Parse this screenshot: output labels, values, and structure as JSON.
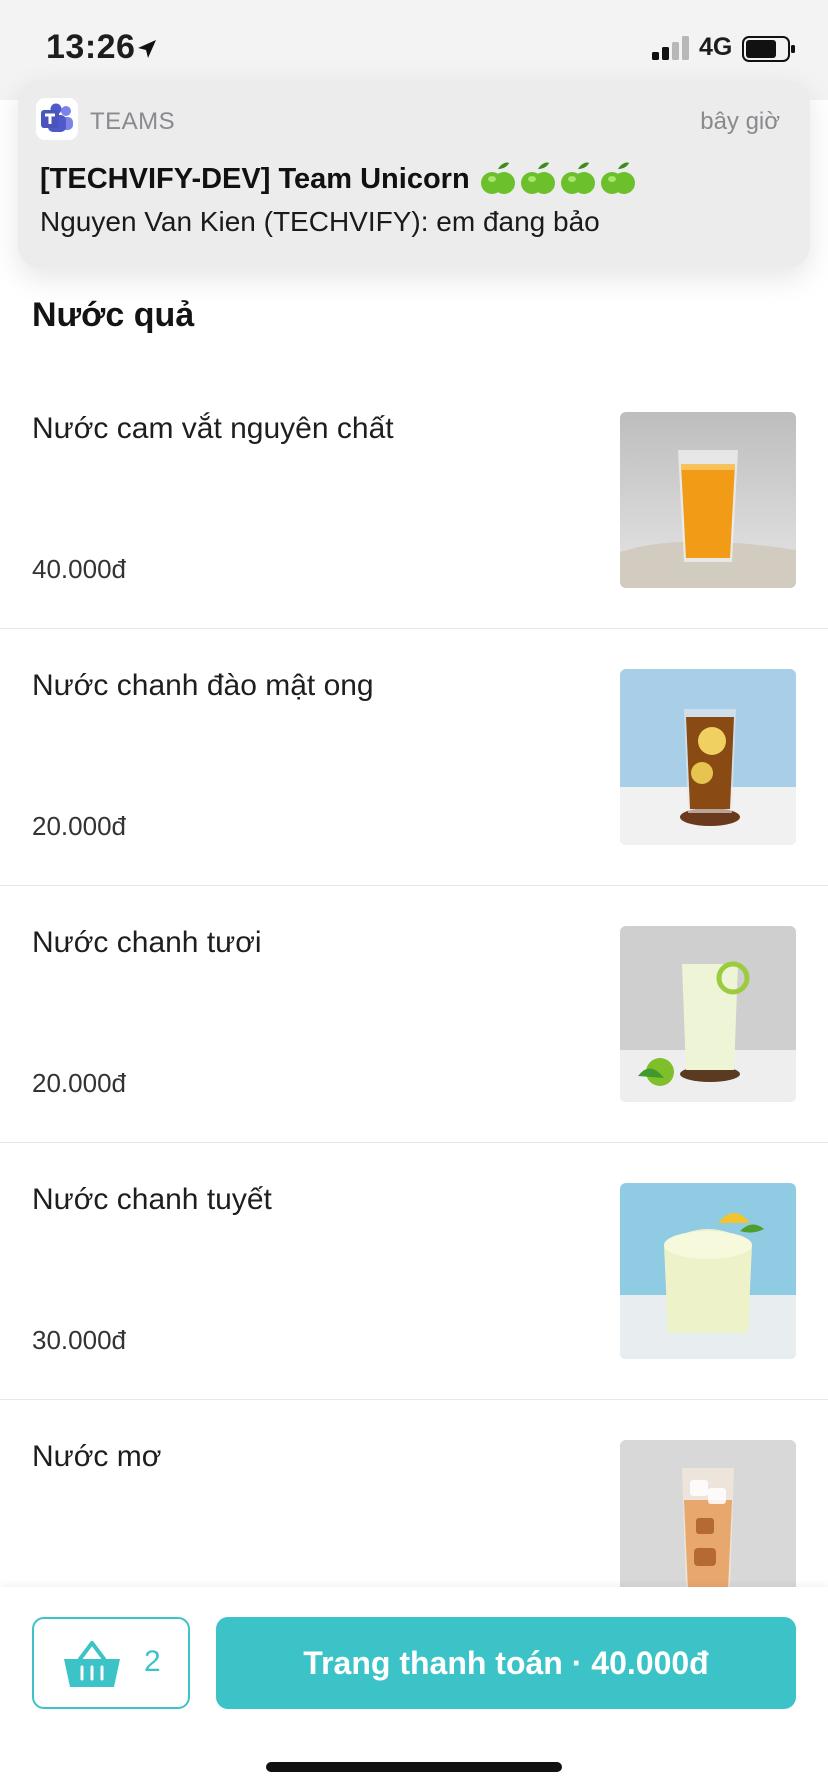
{
  "status_bar": {
    "time": "13:26",
    "network": "4G",
    "icons": [
      "location-arrow-icon",
      "signal-icon",
      "battery-icon"
    ]
  },
  "notification": {
    "app_name": "TEAMS",
    "time": "bây giờ",
    "title": "[TECHVIFY-DEV] Team Unicorn",
    "title_emoji_icons": [
      "green-apple-icon",
      "green-apple-icon",
      "green-apple-icon",
      "green-apple-icon"
    ],
    "body": "Nguyen Van Kien (TECHVIFY): em đang bảo",
    "icon": "teams-icon"
  },
  "section": {
    "title": "Nước quả"
  },
  "products": [
    {
      "name": "Nước cam vắt nguyên chất",
      "price": "40.000đ",
      "image_icon": "orange-juice-image"
    },
    {
      "name": "Nước chanh đào mật ong",
      "price": "20.000đ",
      "image_icon": "peach-lemon-honey-image"
    },
    {
      "name": "Nước chanh tươi",
      "price": "20.000đ",
      "image_icon": "fresh-lemonade-image"
    },
    {
      "name": "Nước chanh tuyết",
      "price": "30.000đ",
      "image_icon": "lemon-slush-image"
    },
    {
      "name": "Nước mơ",
      "price": "",
      "image_icon": "apricot-drink-image"
    }
  ],
  "bottom_bar": {
    "cart_count": "2",
    "checkout_label": "Trang thanh toán · 40.000đ",
    "cart_icon": "basket-icon"
  },
  "colors": {
    "accent": "#3cc3c8",
    "teams_purple": "#5059c9"
  }
}
